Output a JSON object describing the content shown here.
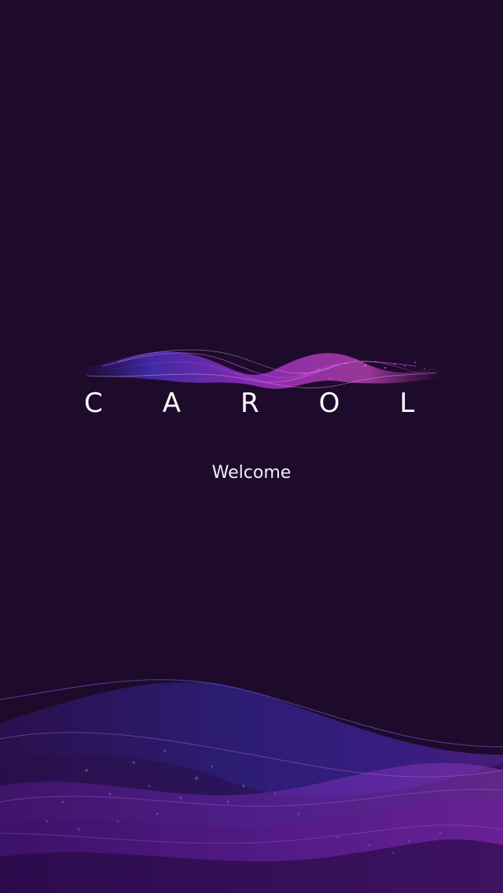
{
  "app": {
    "name": "CAROL"
  },
  "screen": {
    "welcome_text": "Welcome"
  },
  "theme": {
    "background": "#1e0a2a",
    "accent_purple": "#7a2bd0",
    "accent_magenta": "#c23cc4",
    "accent_blue": "#3b2a9c",
    "text_color": "#ffffff"
  },
  "decorations": {
    "logo_wave": "wave-ribbon-graphic",
    "footer_wave": "bottom-wave-graphic"
  }
}
